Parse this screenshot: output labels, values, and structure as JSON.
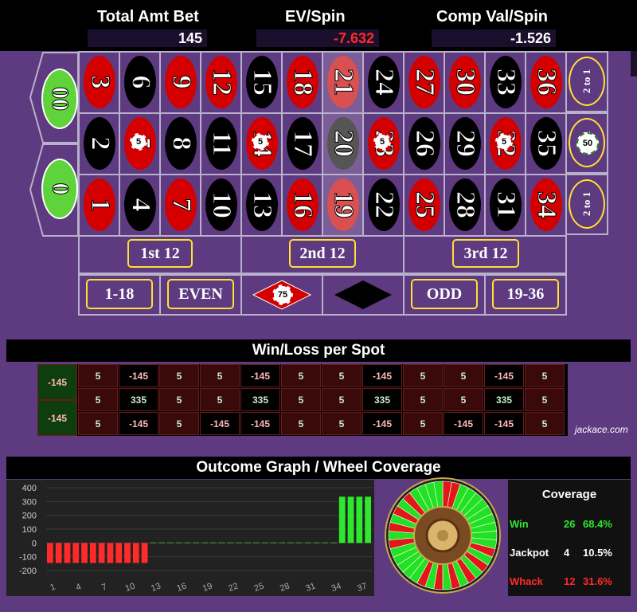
{
  "header": {
    "total_label": "Total Amt Bet",
    "total_value": "145",
    "ev_label": "EV/Spin",
    "ev_value": "-7.632",
    "comp_label": "Comp Val/Spin",
    "comp_value": "-1.526"
  },
  "zeros": [
    "00",
    "0"
  ],
  "rows": [
    {
      "nums": [
        "3",
        "6",
        "9",
        "12",
        "15",
        "18",
        "21",
        "24",
        "27",
        "30",
        "33",
        "36"
      ],
      "colors": [
        "red",
        "black",
        "red",
        "red",
        "black",
        "red",
        "red",
        "black",
        "red",
        "red",
        "black",
        "red"
      ],
      "side": "2 to 1"
    },
    {
      "nums": [
        "2",
        "5",
        "8",
        "11",
        "14",
        "17",
        "20",
        "23",
        "26",
        "29",
        "32",
        "35"
      ],
      "colors": [
        "black",
        "red",
        "black",
        "black",
        "red",
        "black",
        "black",
        "red",
        "black",
        "black",
        "red",
        "black"
      ],
      "side": "2 to 1"
    },
    {
      "nums": [
        "1",
        "4",
        "7",
        "10",
        "13",
        "16",
        "19",
        "22",
        "25",
        "28",
        "31",
        "34"
      ],
      "colors": [
        "red",
        "black",
        "red",
        "black",
        "black",
        "red",
        "red",
        "black",
        "red",
        "black",
        "black",
        "red"
      ],
      "side": "2 to 1"
    }
  ],
  "dozens": [
    "1st 12",
    "2nd 12",
    "3rd 12"
  ],
  "outside": {
    "low": "1-18",
    "even": "EVEN",
    "odd": "ODD",
    "high": "19-36"
  },
  "chips": {
    "inside": "5",
    "column": "50",
    "red": "75"
  },
  "winloss": {
    "title": "Win/Loss per Spot",
    "zero_cells": [
      "-145",
      "-145"
    ],
    "grid": [
      [
        "5",
        "-145",
        "5",
        "5",
        "-145",
        "5",
        "5",
        "-145",
        "5",
        "5",
        "-145",
        "5"
      ],
      [
        "5",
        "335",
        "5",
        "5",
        "335",
        "5",
        "5",
        "335",
        "5",
        "5",
        "335",
        "5"
      ],
      [
        "5",
        "-145",
        "5",
        "-145",
        "-145",
        "5",
        "5",
        "-145",
        "5",
        "-145",
        "-145",
        "5"
      ]
    ],
    "watermark": "jackace.com"
  },
  "outcome": {
    "title": "Outcome Graph / Wheel Coverage"
  },
  "chart_data": {
    "type": "bar",
    "x_ticks": [
      "1",
      "4",
      "7",
      "10",
      "13",
      "16",
      "19",
      "22",
      "25",
      "28",
      "31",
      "34",
      "37"
    ],
    "y_ticks": [
      "400",
      "300",
      "200",
      "100",
      "0",
      "-100",
      "-200"
    ],
    "ylim": [
      -200,
      400
    ],
    "values": [
      -145,
      -145,
      -145,
      -145,
      -145,
      -145,
      -145,
      -145,
      -145,
      -145,
      -145,
      -145,
      5,
      5,
      5,
      5,
      5,
      5,
      5,
      5,
      5,
      5,
      5,
      5,
      5,
      5,
      5,
      5,
      5,
      5,
      5,
      5,
      5,
      5,
      335,
      335,
      335,
      335
    ],
    "colors": {
      "neg": "#ff2a2a",
      "pos": "#2ee82e",
      "small": "#3a7a3a"
    }
  },
  "coverage": {
    "title": "Coverage",
    "rows": [
      {
        "label": "Win",
        "count": "26",
        "pct": "68.4%",
        "color": "#2ee82e"
      },
      {
        "label": "Jackpot",
        "count": "4",
        "pct": "10.5%",
        "color": "#ffffff"
      },
      {
        "label": "Whack",
        "count": "12",
        "pct": "31.6%",
        "color": "#ff2a2a"
      }
    ]
  },
  "colors": {
    "felt": "#5e3a80",
    "red": "#d40000",
    "green": "#5ed33a",
    "gold": "#ffe033"
  }
}
